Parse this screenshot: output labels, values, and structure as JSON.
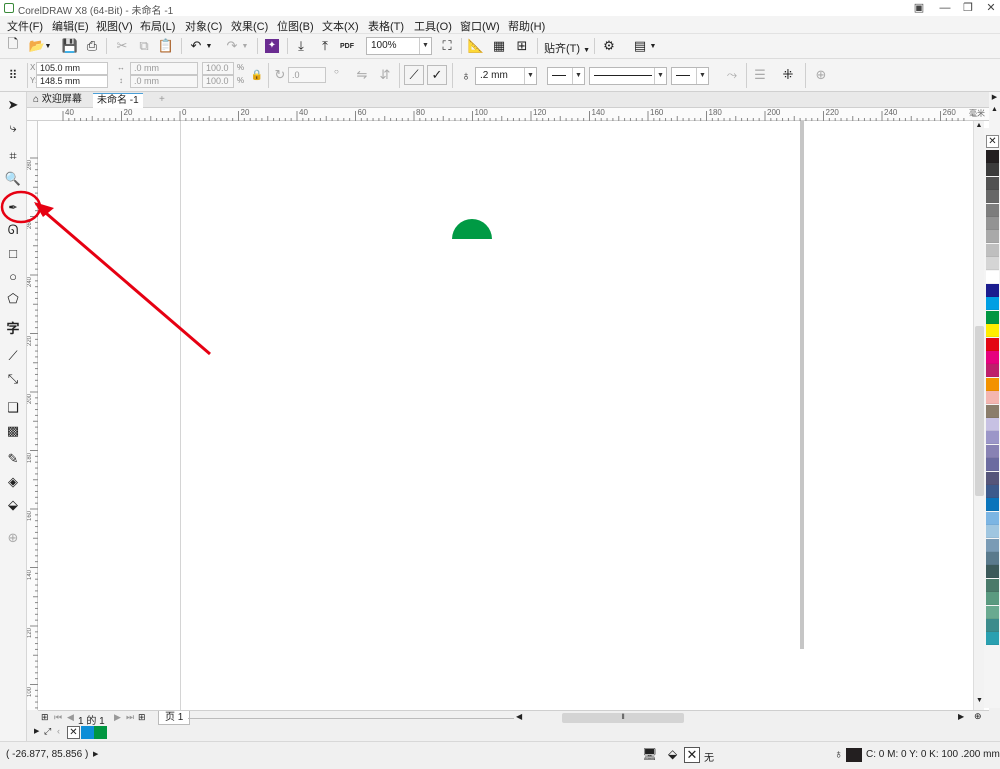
{
  "window": {
    "title": "CorelDRAW X8 (64-Bit) - 未命名 -1"
  },
  "menu": [
    {
      "label": "文件(F)"
    },
    {
      "label": "编辑(E)"
    },
    {
      "label": "视图(V)"
    },
    {
      "label": "布局(L)"
    },
    {
      "label": "对象(C)"
    },
    {
      "label": "效果(C)"
    },
    {
      "label": "位图(B)"
    },
    {
      "label": "文本(X)"
    },
    {
      "label": "表格(T)"
    },
    {
      "label": "工具(O)"
    },
    {
      "label": "窗口(W)"
    },
    {
      "label": "帮助(H)"
    }
  ],
  "standard_bar": {
    "zoom": "100%",
    "snap_label": "贴齐(T)",
    "pdf_label": "PDF"
  },
  "property_bar": {
    "x": "105.0 mm",
    "y": "148.5 mm",
    "width": ".0 mm",
    "height": ".0 mm",
    "scale_x": "100.0",
    "scale_y": "100.0",
    "percent": "%",
    "rotation": ".0",
    "outline_width": ".2 mm"
  },
  "doc_tabs": [
    {
      "label": "欢迎屏幕"
    },
    {
      "label": "未命名 -1"
    }
  ],
  "ruler": {
    "h_labels": [
      "40",
      "20",
      "0",
      "20",
      "40",
      "60",
      "80",
      "100",
      "120",
      "140",
      "160",
      "180",
      "200",
      "220",
      "240",
      "260"
    ],
    "v_labels": [
      "280",
      "260",
      "240",
      "220",
      "200",
      "180",
      "160",
      "140",
      "120",
      "100",
      "80",
      "60",
      "40",
      "20"
    ],
    "units": "毫米"
  },
  "page_nav": {
    "current": "1",
    "of_label": "的",
    "total": "1",
    "page_tab": "页 1"
  },
  "palette_colors": [
    "#231f20",
    "#3b3b3b",
    "#515151",
    "#676767",
    "#7d7d7d",
    "#939393",
    "#a9a9a9",
    "#bfbfbf",
    "#d5d5d5",
    "#ffffff",
    "#1b1d8f",
    "#009fe3",
    "#009641",
    "#ffed00",
    "#e30613",
    "#e6007e",
    "#be1e6b",
    "#f39200",
    "#f4b5b0",
    "#8b7d6b",
    "#c7c1e3",
    "#9b96c8",
    "#8882b4",
    "#6b6ba0",
    "#55557a",
    "#3c5a8c",
    "#0a74bb",
    "#7cb5e3",
    "#a0c6e0",
    "#7a9bb5",
    "#5a7a8c",
    "#3c5a5a",
    "#4a7a6a",
    "#5a9a80",
    "#6aaa90",
    "#3c8c8c",
    "#2aa0b0"
  ],
  "doc_palette": [
    "#0d8ed7",
    "#009641"
  ],
  "status": {
    "cursor": "( -26.877, 85.856 )",
    "fill_none": "无",
    "outline": "C: 0 M: 0 Y: 0 K: 100  .200 mm"
  },
  "colors": {
    "shape_fill": "#009a44",
    "annotation": "#e60012"
  }
}
